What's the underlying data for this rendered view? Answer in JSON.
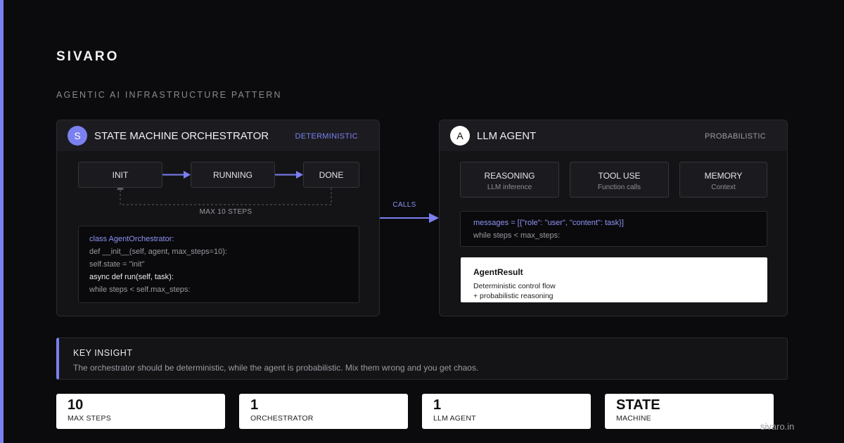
{
  "brand": "SIVARO",
  "subtitle": "AGENTIC AI INFRASTRUCTURE PATTERN",
  "colors": {
    "accent": "#7b80f0",
    "background": "#0b0b0d",
    "panel": "#141417"
  },
  "orchestrator": {
    "icon_letter": "S",
    "title": "STATE MACHINE ORCHESTRATOR",
    "tag": "DETERMINISTIC",
    "states": [
      "INIT",
      "RUNNING",
      "DONE"
    ],
    "loop_label": "MAX 10 STEPS",
    "code": [
      "class AgentOrchestrator:",
      "def __init__(self, agent, max_steps=10):",
      "self.state = \"init\"",
      "async def run(self, task):",
      "while steps < self.max_steps:"
    ]
  },
  "connector_label": "CALLS",
  "agent": {
    "icon_letter": "A",
    "title": "LLM AGENT",
    "tag": "PROBABILISTIC",
    "features": [
      {
        "label": "REASONING",
        "sub": "LLM inference"
      },
      {
        "label": "TOOL USE",
        "sub": "Function calls"
      },
      {
        "label": "MEMORY",
        "sub": "Context"
      }
    ],
    "code": [
      "messages = [{\"role\": \"user\", \"content\": task}]",
      "while steps < max_steps:"
    ],
    "result": {
      "title": "AgentResult",
      "lines": [
        "Deterministic control flow",
        "+ probabilistic reasoning"
      ]
    }
  },
  "insight": {
    "title": "KEY INSIGHT",
    "text": "The orchestrator should be deterministic, while the agent is probabilistic. Mix them wrong and you get chaos."
  },
  "stats": [
    {
      "value": "10",
      "label": "MAX STEPS"
    },
    {
      "value": "1",
      "label": "ORCHESTRATOR"
    },
    {
      "value": "1",
      "label": "LLM AGENT"
    },
    {
      "value": "STATE",
      "label": "MACHINE"
    }
  ],
  "footer": "sivaro.in"
}
